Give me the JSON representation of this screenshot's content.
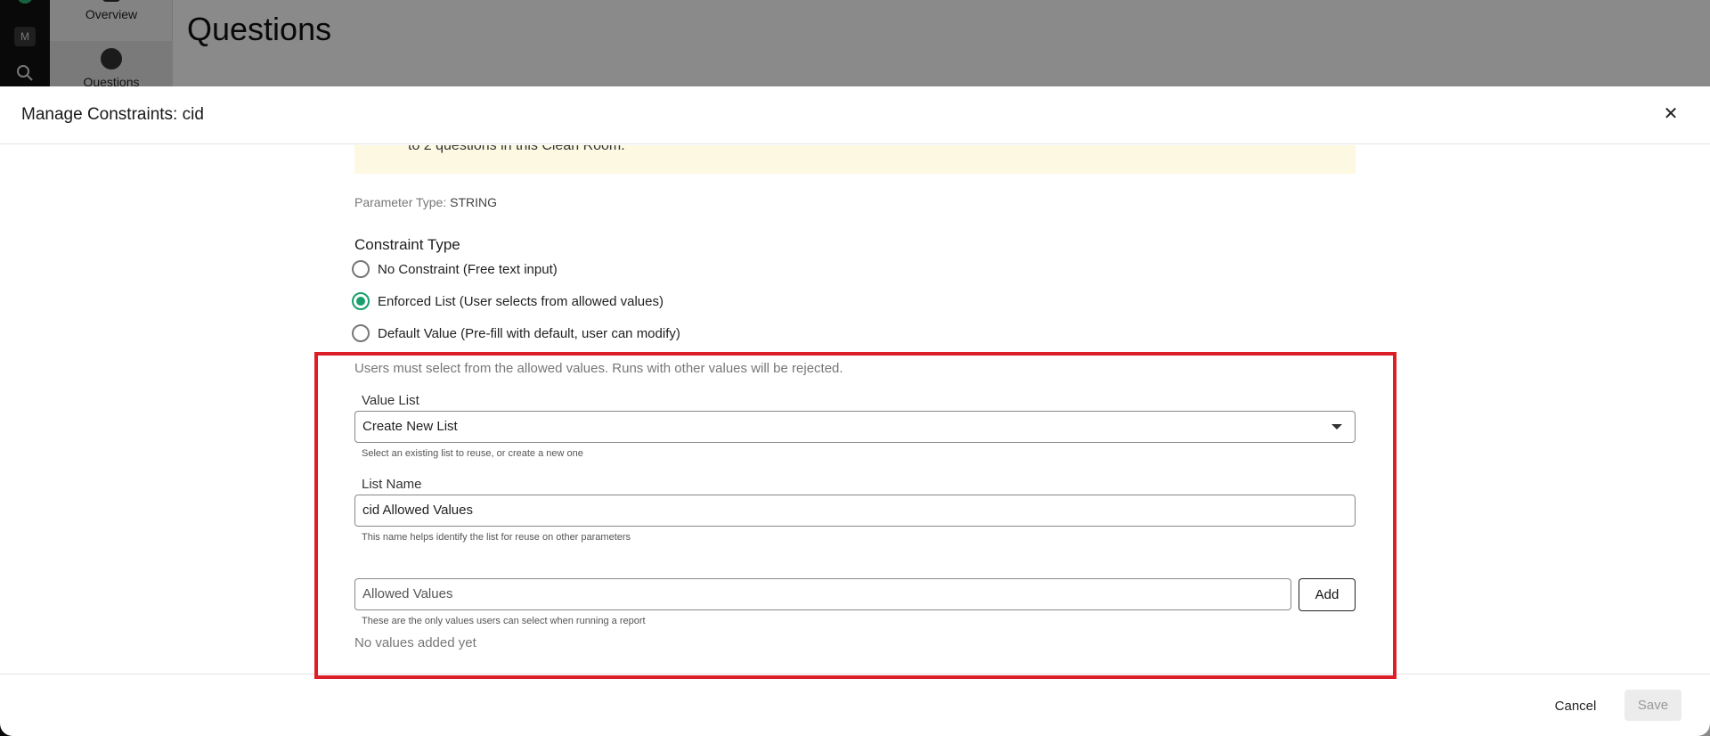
{
  "background": {
    "rail_avatar": "M",
    "subnav": {
      "overview": "Overview",
      "questions": "Questions"
    },
    "page_title": "Questions"
  },
  "modal": {
    "title": "Manage Constraints: cid",
    "close_icon": "close-icon",
    "notice_text": "to 2 questions in this Clean Room.",
    "parameter_type_label": "Parameter Type:",
    "parameter_type_value": "STRING",
    "constraint_type_label": "Constraint Type",
    "constraint_options": [
      {
        "label": "No Constraint (Free text input)",
        "selected": false
      },
      {
        "label": "Enforced List (User selects from allowed values)",
        "selected": true
      },
      {
        "label": "Default Value (Pre-fill with default, user can modify)",
        "selected": false
      }
    ],
    "enforced_help": "Users must select from the allowed values. Runs with other values will be rejected.",
    "value_list": {
      "label": "Value List",
      "selected": "Create New List",
      "hint": "Select an existing list to reuse, or create a new one"
    },
    "list_name": {
      "label": "List Name",
      "value": "cid Allowed Values",
      "hint": "This name helps identify the list for reuse on other parameters"
    },
    "allowed_values": {
      "placeholder": "Allowed Values",
      "add_label": "Add",
      "hint": "These are the only values users can select when running a report",
      "empty_text": "No values added yet"
    },
    "footer": {
      "cancel_label": "Cancel",
      "save_label": "Save"
    }
  },
  "colors": {
    "accent": "#17a06b",
    "highlight": "#dc1e26",
    "notice_bg": "#fdf8e2"
  }
}
